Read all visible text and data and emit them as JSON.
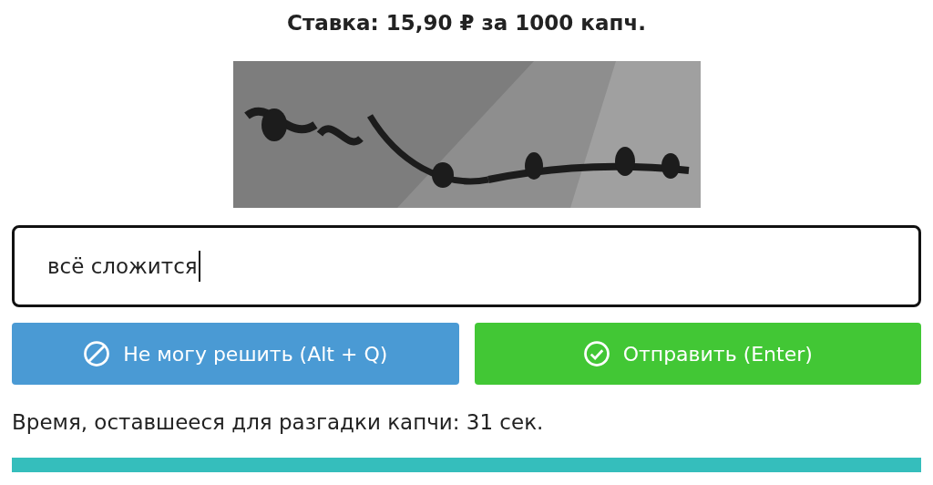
{
  "rate": "Ставка: 15,90 ₽ за 1000 капч.",
  "answer": {
    "value": "всё сложится"
  },
  "buttons": [
    {
      "label": "Не могу решить (Alt + Q)",
      "kind": "skip"
    },
    {
      "label": "Отправить (Enter)",
      "kind": "submit"
    }
  ],
  "timer": {
    "text": "Время, оставшееся для разгадки капчи: 31 сек."
  }
}
